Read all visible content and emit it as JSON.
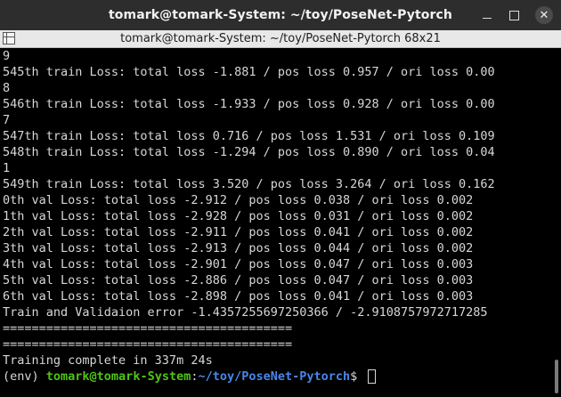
{
  "window": {
    "title": "tomark@tomark-System: ~/toy/PoseNet-Pytorch",
    "controls": {
      "minimize_icon": "minimize-icon",
      "maximize_icon": "maximize-icon",
      "close_icon": "close-icon",
      "close_glyph": "✕"
    }
  },
  "tab": {
    "label": "tomark@tomark-System: ~/toy/PoseNet-Pytorch 68x21"
  },
  "terminal": {
    "lines": [
      "9",
      "545th train Loss: total loss -1.881 / pos loss 0.957 / ori loss 0.00",
      "8",
      "546th train Loss: total loss -1.933 / pos loss 0.928 / ori loss 0.00",
      "7",
      "547th train Loss: total loss 0.716 / pos loss 1.531 / ori loss 0.109",
      "548th train Loss: total loss -1.294 / pos loss 0.890 / ori loss 0.04",
      "1",
      "549th train Loss: total loss 3.520 / pos loss 3.264 / ori loss 0.162",
      "0th val Loss: total loss -2.912 / pos loss 0.038 / ori loss 0.002",
      "1th val Loss: total loss -2.928 / pos loss 0.031 / ori loss 0.002",
      "2th val Loss: total loss -2.911 / pos loss 0.041 / ori loss 0.002",
      "3th val Loss: total loss -2.913 / pos loss 0.044 / ori loss 0.002",
      "4th val Loss: total loss -2.901 / pos loss 0.047 / ori loss 0.003",
      "5th val Loss: total loss -2.886 / pos loss 0.047 / ori loss 0.003",
      "6th val Loss: total loss -2.898 / pos loss 0.041 / ori loss 0.003",
      "Train and Validaion error -1.4357255697250366 / -2.9108757972717285",
      "========================================",
      "========================================",
      "Training complete in 337m 24s"
    ],
    "prompt": {
      "env": "(env) ",
      "user_host": "tomark@tomark-System",
      "separator": ":",
      "path": "~/toy/PoseNet-Pytorch",
      "symbol": "$ "
    }
  },
  "colors": {
    "title_bg": "#2d2d2d",
    "tab_bg": "#e8e8e8",
    "terminal_bg": "#000000",
    "terminal_fg": "#d7d7d7",
    "prompt_user": "#4fc414",
    "prompt_path": "#4a86e8"
  }
}
